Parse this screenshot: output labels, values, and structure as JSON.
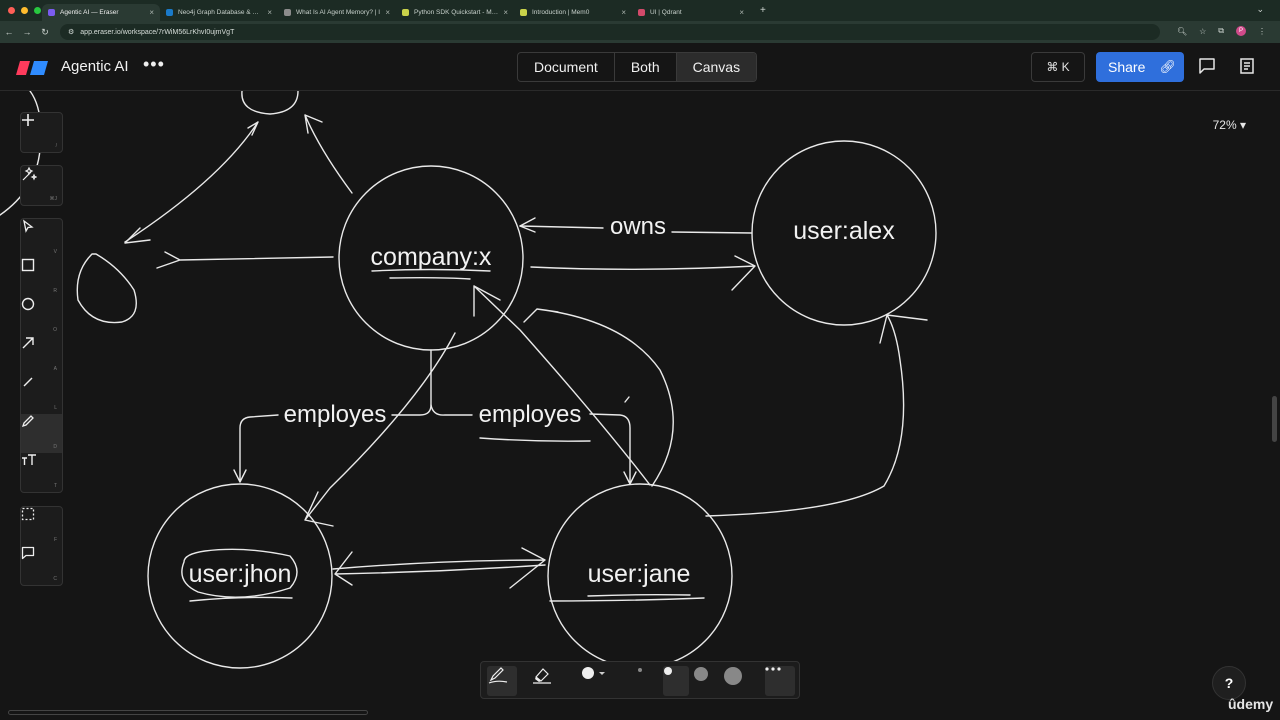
{
  "browser": {
    "tabs": [
      {
        "title": "Agentic AI — Eraser",
        "color": "#7b5cf0",
        "active": true
      },
      {
        "title": "Neo4j Graph Database & Ana",
        "color": "#1a7ac9"
      },
      {
        "title": "What Is AI Agent Memory? | I",
        "color": "#8c8c8c"
      },
      {
        "title": "Python SDK Quickstart - Mem",
        "color": "#c9d24a"
      },
      {
        "title": "Introduction | Mem0",
        "color": "#c9d24a"
      },
      {
        "title": "UI | Qdrant",
        "color": "#d24a6a"
      }
    ],
    "url": "app.eraser.io/workspace/7rWiM56LrKhvI0ujmVgT",
    "profile_initial": "P"
  },
  "header": {
    "title": "Agentic AI",
    "view_modes": [
      "Document",
      "Both",
      "Canvas"
    ],
    "active_view": "Canvas",
    "command_shortcut": "⌘ K",
    "share_label": "Share"
  },
  "canvas": {
    "zoom": "72%",
    "nodes": {
      "company": "company:x",
      "alex": "user:alex",
      "jhon": "user:jhon",
      "jane": "user:jane"
    },
    "edges": {
      "owns": "owns",
      "employes_left": "employes",
      "employes_right": "employes"
    }
  },
  "toolbar": {
    "tools": [
      {
        "name": "add",
        "hint": "/"
      },
      {
        "name": "ai",
        "hint": "⌘J"
      },
      {
        "name": "select",
        "hint": "V"
      },
      {
        "name": "rectangle",
        "hint": "R"
      },
      {
        "name": "ellipse",
        "hint": "O"
      },
      {
        "name": "arrow",
        "hint": "A"
      },
      {
        "name": "line",
        "hint": "L"
      },
      {
        "name": "pencil",
        "hint": "D"
      },
      {
        "name": "text",
        "hint": "T"
      },
      {
        "name": "frame",
        "hint": "F"
      },
      {
        "name": "comment",
        "hint": "C"
      }
    ]
  },
  "help_label": "?",
  "watermark": "ûdemy"
}
